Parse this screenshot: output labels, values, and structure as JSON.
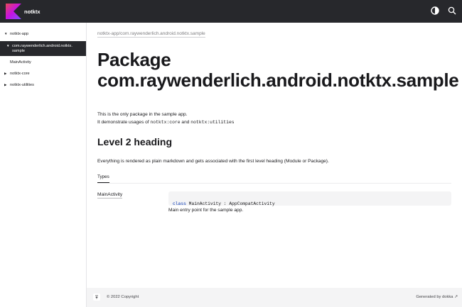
{
  "header": {
    "app_name": "notktx",
    "icons": [
      "kotlin-logo",
      "theme-toggle-icon",
      "search-icon"
    ],
    "background": "#27282c"
  },
  "sidebar": {
    "items": [
      {
        "label": "notktx-app",
        "arrow": "▼"
      },
      {
        "label": "com.raywenderlich.android.notktx.\nsample",
        "arrow": "▼",
        "selected": true
      },
      {
        "label": "MainActivity",
        "arrow": ""
      },
      {
        "label": "notktx-core",
        "arrow": "▶"
      },
      {
        "label": "notktx-utilities",
        "arrow": "▶"
      }
    ],
    "selected_background": "#27282c"
  },
  "main": {
    "breadcrumb": "notktx-app/com.raywenderlich.android.notktx.sample",
    "title": "Package com.raywenderlich.android.notktx.sample",
    "intro_1": "This is the only package in the sample app.",
    "intro_2_prefix": "It demonstrate usages of ",
    "intro_2_code1": "notktx:core",
    "intro_2_mid": " and ",
    "intro_2_code2": "notktx:utilities",
    "heading_2": "Level 2 heading",
    "paragraph": "Everything is rendered as plain markdown and gets associated with the first level heading (Module or Package).",
    "tab_types": "Types",
    "type_name": "MainActivity",
    "signature_keyword": "class",
    "signature_rest": " MainActivity : AppCompatActivity",
    "type_description": "Main entry point for the sample app."
  },
  "footer": {
    "copyright": "© 2022 Copyright",
    "generated_by": "Generated by dokka ↗"
  }
}
